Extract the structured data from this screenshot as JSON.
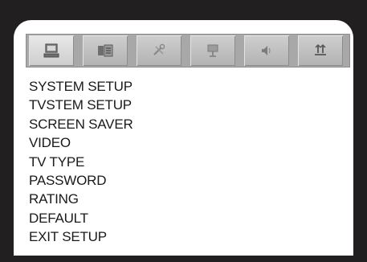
{
  "tabs": [
    {
      "icon": "system-monitor-icon",
      "active": true
    },
    {
      "icon": "language-icon",
      "active": false
    },
    {
      "icon": "audio-tools-icon",
      "active": false
    },
    {
      "icon": "video-icon",
      "active": false
    },
    {
      "icon": "speaker-icon",
      "active": false
    },
    {
      "icon": "digital-setup-icon",
      "active": false
    }
  ],
  "menu": {
    "items": [
      "SYSTEM SETUP",
      "TVSTEM SETUP",
      "SCREEN SAVER",
      "VIDEO",
      "TV TYPE",
      "PASSWORD",
      "RATING",
      "DEFAULT",
      "EXIT SETUP"
    ]
  }
}
